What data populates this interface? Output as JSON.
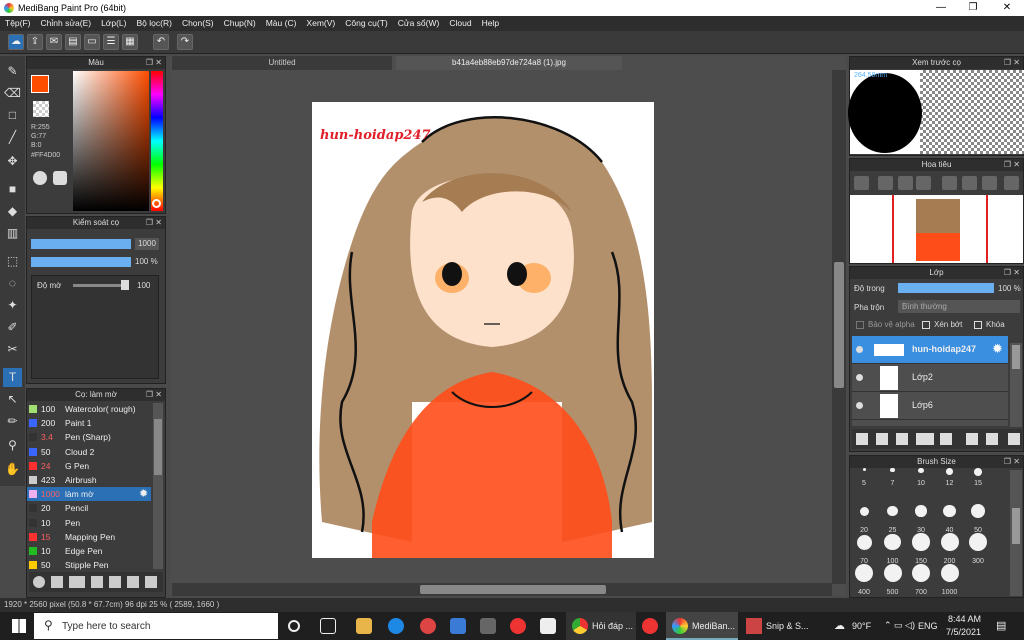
{
  "window": {
    "title": "MediBang Paint Pro (64bit)"
  },
  "menu": [
    "Tệp(F)",
    "Chỉnh sửa(E)",
    "Lớp(L)",
    "Bộ lọc(R)",
    "Chọn(S)",
    "Chụp(N)",
    "Màu (C)",
    "Xem(V)",
    "Công cụ(T)",
    "Cửa sổ(W)",
    "Cloud",
    "Help"
  ],
  "color_panel": {
    "title": "Màu",
    "r": "R:255",
    "g": "G:77",
    "b": "B:0",
    "hex": "#FF4D00",
    "fg": "#ff4d00"
  },
  "brush_control": {
    "title": "Kiểm soát cọ",
    "size": "1000",
    "opacity": "100 %",
    "blur_label": "Độ mờ",
    "blur_value": "100"
  },
  "brush_panel": {
    "title": "Cọ: làm mờ",
    "items": [
      {
        "size": "100",
        "name": "Watercolor( rough)",
        "color": "#a0e070"
      },
      {
        "size": "200",
        "name": "Paint 1",
        "color": "#3a66ff"
      },
      {
        "size": "3.4",
        "name": "Pen (Sharp)",
        "color": "#333333"
      },
      {
        "size": "50",
        "name": "Cloud 2",
        "color": "#3a66ff"
      },
      {
        "size": "24",
        "name": "G Pen",
        "color": "#ff3030"
      },
      {
        "size": "423",
        "name": "Airbrush",
        "color": "#cccccc"
      },
      {
        "size": "1000",
        "name": "làm mờ",
        "color": "#f0b0f0"
      },
      {
        "size": "20",
        "name": "Pencil",
        "color": "#333333"
      },
      {
        "size": "10",
        "name": "Pen",
        "color": "#333333"
      },
      {
        "size": "15",
        "name": "Mapping Pen",
        "color": "#ff3030"
      },
      {
        "size": "10",
        "name": "Edge Pen",
        "color": "#22bb22"
      },
      {
        "size": "50",
        "name": "Stipple Pen",
        "color": "#ffcc00"
      }
    ]
  },
  "tabs": [
    "Untitled",
    "b41a4eb88eb97de724a8 (1).jpg"
  ],
  "canvas": {
    "watermark": "hun-hoidap247"
  },
  "preview": {
    "title": "Xem trước cọ",
    "size": "264.58mm"
  },
  "navigator": {
    "title": "Hoa tiêu"
  },
  "layers": {
    "title": "Lớp",
    "opacity_label": "Độ trong",
    "opacity_value": "100 %",
    "blend_label": "Pha trộn",
    "blend_value": "Bình thường",
    "alpha_label": "Bảo vệ alpha",
    "clip_label": "Xén bớt",
    "lock_label": "Khóa",
    "items": [
      "hun-hoidap247",
      "Lớp2",
      "Lớp6"
    ]
  },
  "brush_size": {
    "title": "Brush Size",
    "values": [
      "5",
      "7",
      "10",
      "12",
      "15",
      "20",
      "25",
      "30",
      "40",
      "50",
      "70",
      "100",
      "150",
      "200",
      "300",
      "400",
      "500",
      "700",
      "1000"
    ]
  },
  "status": "1920 * 2560 pixel  (50.8 * 67.7cm)  96 dpi  25 %  ( 2589, 1660 )",
  "taskbar": {
    "search": "Type here to search",
    "app1": "Hỏi đáp ...",
    "app2": "MediBan...",
    "app3": "Snip & S...",
    "temp": "90°F",
    "lang": "ENG",
    "time": "8:44 AM",
    "date": "7/5/2021"
  }
}
